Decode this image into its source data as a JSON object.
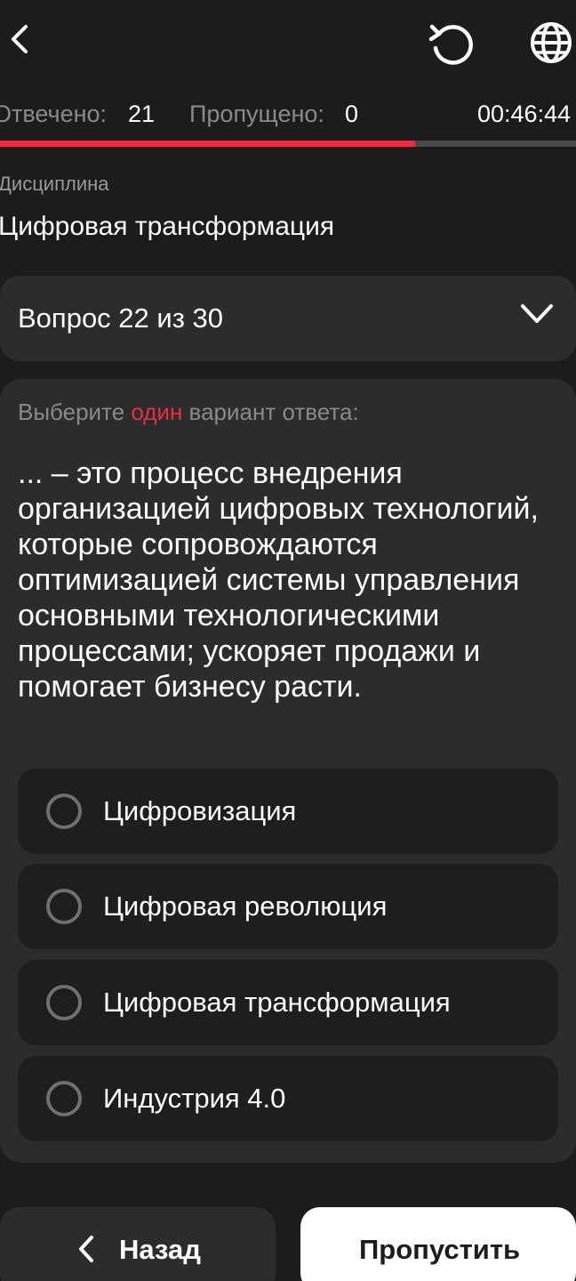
{
  "stats": {
    "answered_label": "Отвечено:",
    "answered_value": "21",
    "skipped_label": "Пропущено:",
    "skipped_value": "0",
    "timer": "00:46:44"
  },
  "progress": {
    "fraction": 0.72,
    "fill_color": "#e8303c",
    "track_color": "#4a4a4a"
  },
  "discipline": {
    "label": "Дисциплина",
    "value": "Цифровая трансформация"
  },
  "question_selector": {
    "label": "Вопрос 22 из 30"
  },
  "question": {
    "instruction_before": "Выберите ",
    "instruction_highlight": "один",
    "instruction_after": " вариант ответа:",
    "text": "... – это процесс внедрения организацией цифровых технологий, которые сопровождаются оптимизацией системы управления основными технологическими процессами; ускоряет продажи и помогает бизнесу расти.",
    "options": [
      {
        "label": "Цифровизация"
      },
      {
        "label": "Цифровая революция"
      },
      {
        "label": "Цифровая трансформация"
      },
      {
        "label": "Индустрия 4.0"
      }
    ]
  },
  "nav": {
    "back_label": "Назад",
    "skip_label": "Пропустить"
  },
  "icons": {
    "back": "chevron-left-icon",
    "restart": "restart-icon",
    "language": "globe-icon",
    "dropdown": "chevron-down-icon"
  },
  "colors": {
    "accent": "#e8303c",
    "background": "#1c1c1c",
    "card": "#2c2c2c"
  }
}
